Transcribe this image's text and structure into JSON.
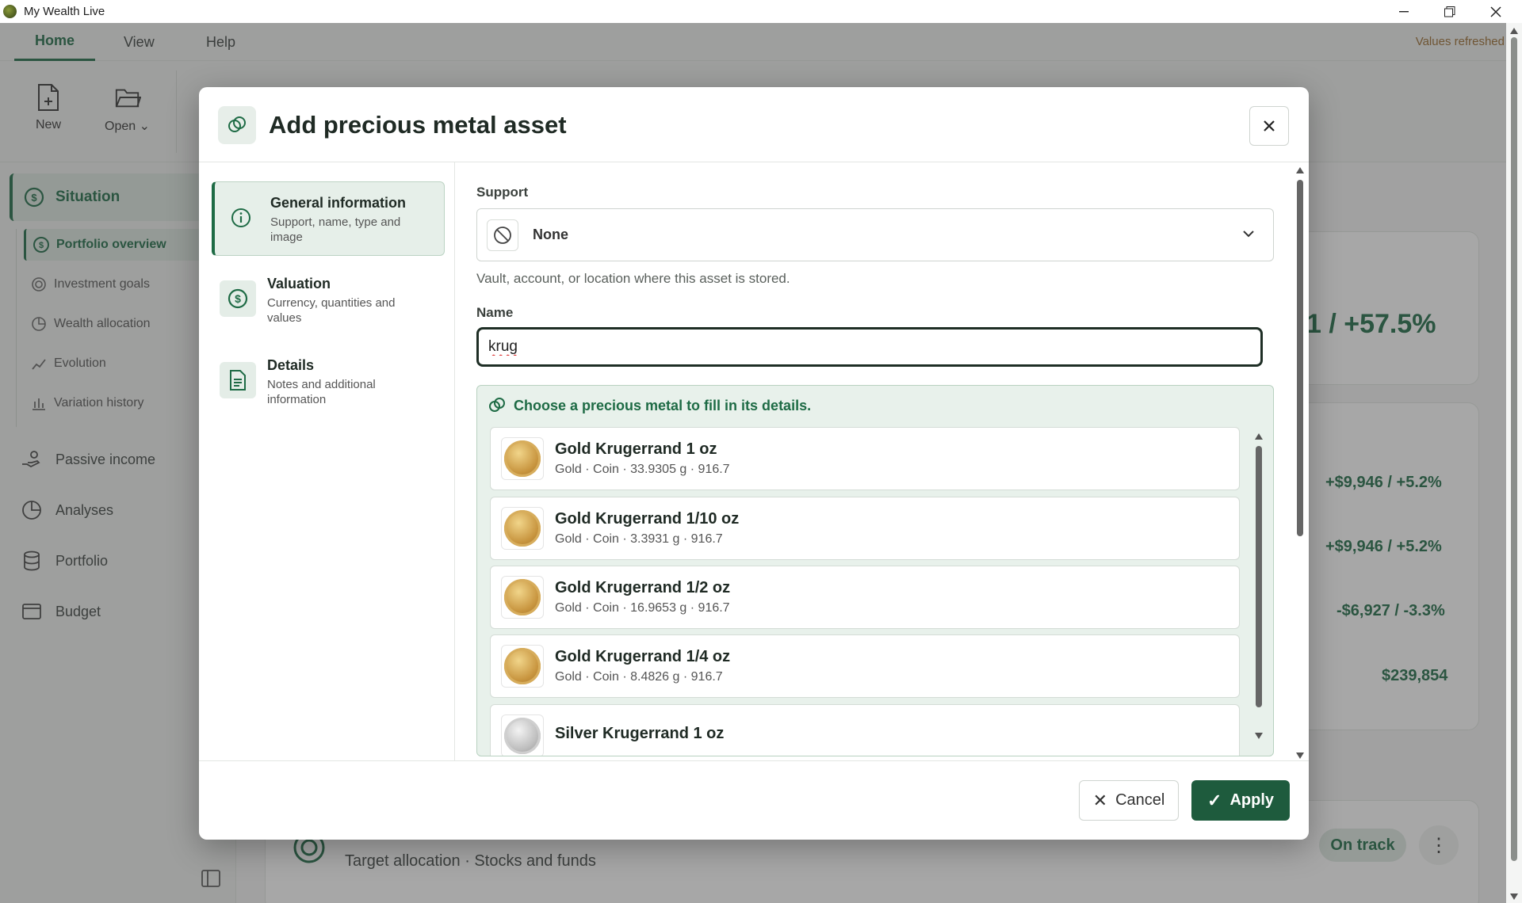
{
  "window": {
    "title": "My Wealth Live"
  },
  "menu": {
    "tabs": [
      {
        "label": "Home",
        "active": true
      },
      {
        "label": "View",
        "active": false
      },
      {
        "label": "Help",
        "active": false
      }
    ],
    "status": "Values refreshed"
  },
  "ribbon": {
    "new_label": "New",
    "open_label": "Open ⌄"
  },
  "sidebar": {
    "situation_label": "Situation",
    "sub_items": [
      {
        "label": "Portfolio overview",
        "icon": "dollar-circle-icon",
        "active": true
      },
      {
        "label": "Investment goals",
        "icon": "target-icon",
        "active": false
      },
      {
        "label": "Wealth allocation",
        "icon": "pie-icon",
        "active": false
      },
      {
        "label": "Evolution",
        "icon": "trend-icon",
        "active": false
      },
      {
        "label": "Variation history",
        "icon": "bar-chart-icon",
        "active": false
      }
    ],
    "main_items": [
      {
        "label": "Passive income",
        "icon": "hand-coins-icon"
      },
      {
        "label": "Analyses",
        "icon": "pie-chart-icon"
      },
      {
        "label": "Portfolio",
        "icon": "database-icon"
      },
      {
        "label": "Budget",
        "icon": "wallet-icon"
      }
    ]
  },
  "background": {
    "headline_value": "1 / +57.5%",
    "rows": [
      "+$9,946 / +5.2%",
      "+$9,946 / +5.2%",
      "-$6,927 / -3.3%",
      "$239,854"
    ],
    "goal_subtitle": "Target allocation · Stocks and funds",
    "goal_status": "On track"
  },
  "dialog": {
    "title": "Add precious metal asset",
    "steps": [
      {
        "title": "General information",
        "desc": "Support, name, type and image",
        "icon": "info-icon",
        "active": true
      },
      {
        "title": "Valuation",
        "desc": "Currency, quantities and values",
        "icon": "dollar-circle-icon",
        "active": false
      },
      {
        "title": "Details",
        "desc": "Notes and additional information",
        "icon": "document-icon",
        "active": false
      }
    ],
    "support": {
      "label": "Support",
      "value": "None",
      "helper": "Vault, account, or location where this asset is stored."
    },
    "name": {
      "label": "Name",
      "value": "krug"
    },
    "suggestions": {
      "header": "Choose a precious metal to fill in its details.",
      "items": [
        {
          "name": "Gold Krugerrand 1 oz",
          "desc": "Gold · Coin · 33.9305 g · 916.7",
          "metal": "gold"
        },
        {
          "name": "Gold Krugerrand 1/10 oz",
          "desc": "Gold · Coin · 3.3931 g · 916.7",
          "metal": "gold"
        },
        {
          "name": "Gold Krugerrand 1/2 oz",
          "desc": "Gold · Coin · 16.9653 g · 916.7",
          "metal": "gold"
        },
        {
          "name": "Gold Krugerrand 1/4 oz",
          "desc": "Gold · Coin · 8.4826 g · 916.7",
          "metal": "gold"
        },
        {
          "name": "Silver Krugerrand 1 oz",
          "desc": "",
          "metal": "silver"
        }
      ]
    },
    "buttons": {
      "cancel": "Cancel",
      "apply": "Apply"
    }
  },
  "colors": {
    "accent": "#1e6b45",
    "apply_bg": "#1e5b3d",
    "status_text": "#9a6a2e"
  }
}
